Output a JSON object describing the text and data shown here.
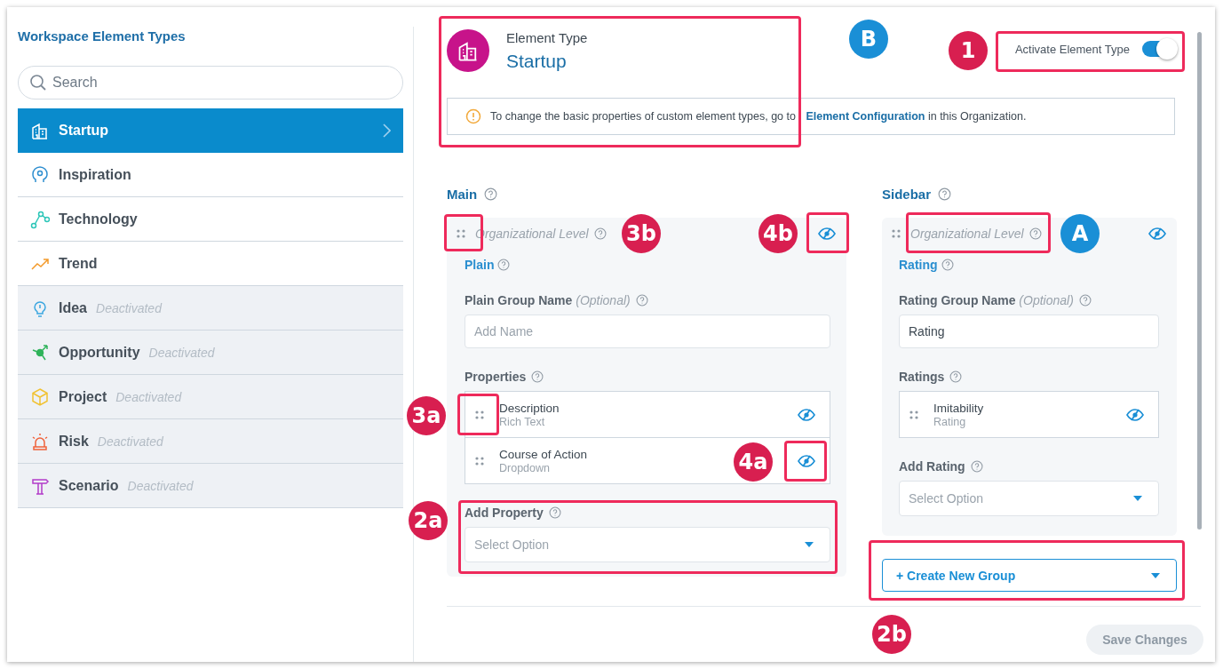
{
  "sidebar": {
    "title": "Workspace Element Types",
    "search": {
      "placeholder": "Search"
    },
    "items": [
      {
        "kind": "startup",
        "label": "Startup",
        "selected": true,
        "deactivated": false
      },
      {
        "kind": "inspiration",
        "label": "Inspiration",
        "selected": false,
        "deactivated": false
      },
      {
        "kind": "technology",
        "label": "Technology",
        "selected": false,
        "deactivated": false
      },
      {
        "kind": "trend",
        "label": "Trend",
        "selected": false,
        "deactivated": false
      },
      {
        "kind": "idea",
        "label": "Idea",
        "status": "Deactivated",
        "selected": false,
        "deactivated": true
      },
      {
        "kind": "opportunity",
        "label": "Opportunity",
        "status": "Deactivated",
        "selected": false,
        "deactivated": true
      },
      {
        "kind": "project",
        "label": "Project",
        "status": "Deactivated",
        "selected": false,
        "deactivated": true
      },
      {
        "kind": "risk",
        "label": "Risk",
        "status": "Deactivated",
        "selected": false,
        "deactivated": true
      },
      {
        "kind": "scenario",
        "label": "Scenario",
        "status": "Deactivated",
        "selected": false,
        "deactivated": true
      }
    ]
  },
  "header": {
    "label": "Element Type",
    "title": "Startup",
    "activate": {
      "label": "Activate Element Type",
      "on": true
    }
  },
  "notice": {
    "before": "To change the basic properties of custom element types, go to ",
    "link": "Element Configuration",
    "after": " in this Organization."
  },
  "groups": [
    {
      "title": "Main",
      "level": "Organizational Level",
      "type": "Plain",
      "name_label": "Plain Group Name",
      "optional": "(Optional)",
      "name_field": {
        "placeholder": "Add Name"
      },
      "list_label": "Properties",
      "items": [
        {
          "name": "Description",
          "type": "Rich Text"
        },
        {
          "name": "Course of Action",
          "type": "Dropdown"
        }
      ],
      "add_label": "Add Property",
      "add_select": {
        "placeholder": "Select Option"
      }
    },
    {
      "title": "Sidebar",
      "level": "Organizational Level",
      "type": "Rating",
      "name_label": "Rating Group Name",
      "optional": "(Optional)",
      "name_field": {
        "value": "Rating"
      },
      "list_label": "Ratings",
      "items": [
        {
          "name": "Imitability",
          "type": "Rating"
        }
      ],
      "add_label": "Add Rating",
      "add_select": {
        "placeholder": "Select Option"
      }
    }
  ],
  "create_group": "+ Create New Group",
  "save": {
    "label": "Save Changes",
    "disabled": true
  },
  "callouts": [
    {
      "label": "B",
      "color": "#1a8fd6"
    },
    {
      "label": "1",
      "color": "#d81f50"
    },
    {
      "label": "3b",
      "color": "#d81f50"
    },
    {
      "label": "4b",
      "color": "#d81f50"
    },
    {
      "label": "A",
      "color": "#1a8fd6"
    },
    {
      "label": "3a",
      "color": "#d81f50"
    },
    {
      "label": "4a",
      "color": "#d81f50"
    },
    {
      "label": "2a",
      "color": "#d81f50"
    },
    {
      "label": "2b",
      "color": "#d81f50"
    }
  ]
}
